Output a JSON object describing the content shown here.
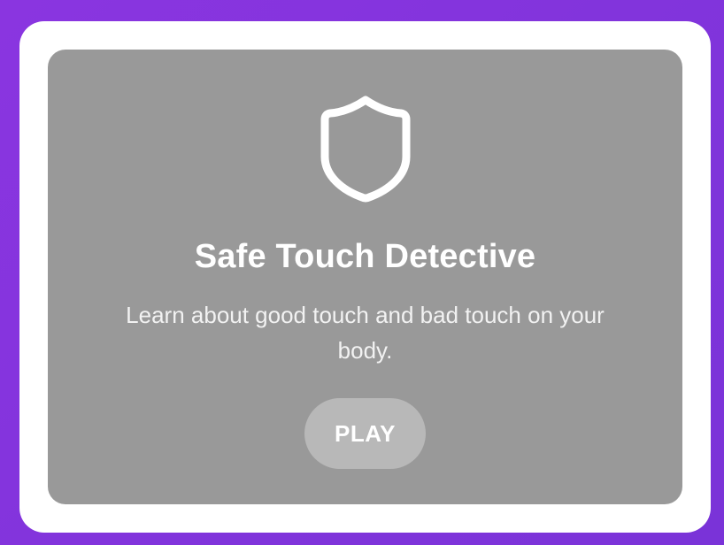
{
  "card": {
    "icon": "shield-icon",
    "title": "Safe Touch Detective",
    "description": "Learn about good touch and bad touch on your body.",
    "play_label": "PLAY"
  },
  "colors": {
    "background": "#8435de",
    "outer_card": "#ffffff",
    "inner_card": "#999999",
    "play_button": "#b8b8b8",
    "text": "#ffffff"
  }
}
